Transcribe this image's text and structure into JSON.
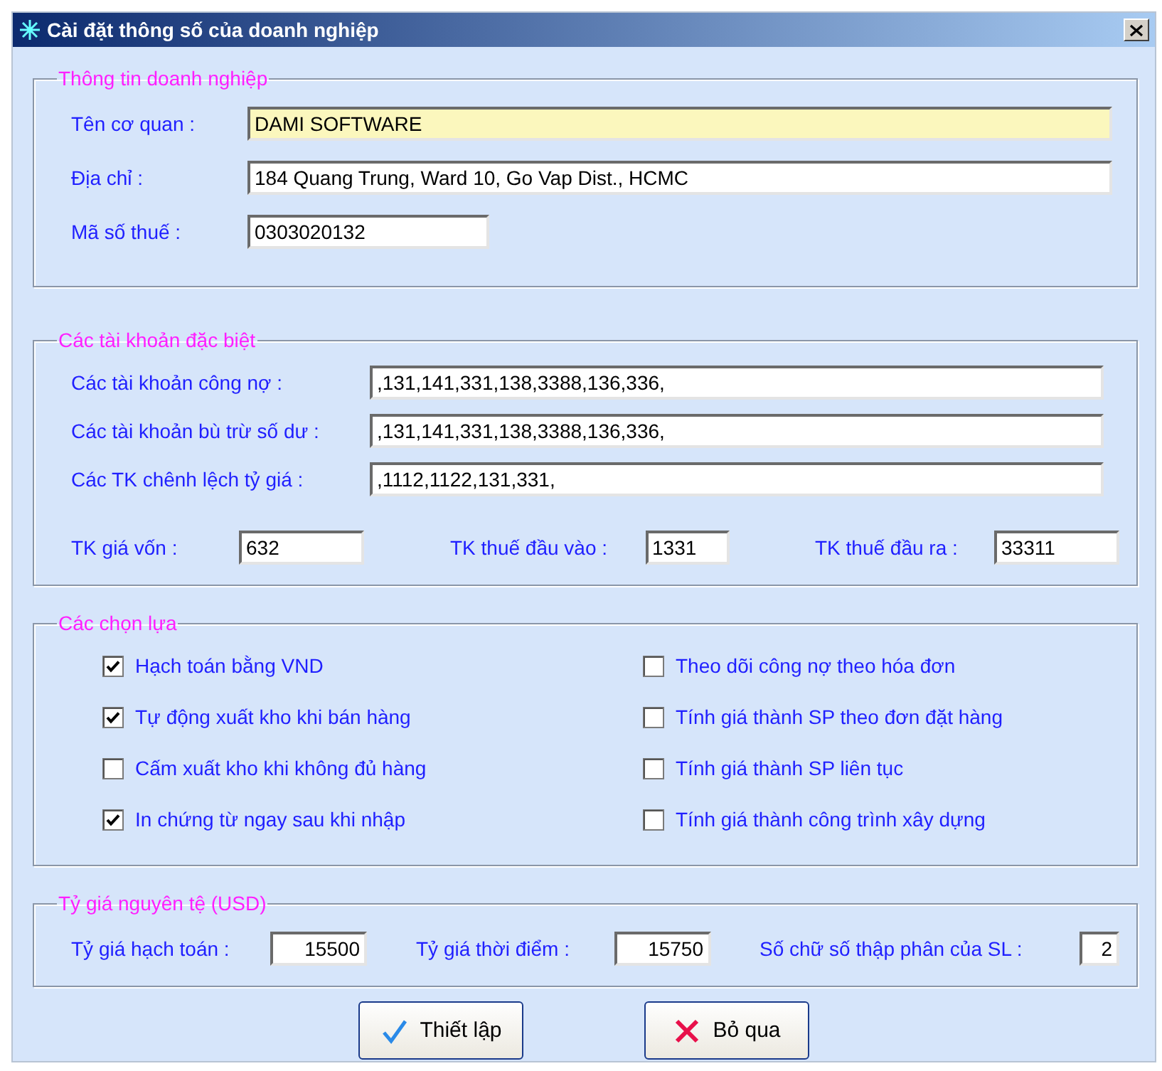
{
  "window": {
    "title": "Cài đặt thông số của doanh nghiệp"
  },
  "company": {
    "legend": "Thông tin doanh nghiệp",
    "fields": [
      {
        "label": "Tên cơ quan :",
        "value": "DAMI SOFTWARE",
        "focused": true
      },
      {
        "label": "Địa chỉ :",
        "value": "184 Quang Trung, Ward 10, Go Vap Dist., HCMC",
        "focused": false
      },
      {
        "label": "Mã số thuế :",
        "value": "0303020132",
        "focused": false
      }
    ]
  },
  "accounts": {
    "legend": "Các tài khoản đặc biệt",
    "fields": [
      {
        "label": "Các tài khoản công nợ :",
        "value": ",131,141,331,138,3388,136,336,"
      },
      {
        "label": "Các tài khoản bù trừ số dư :",
        "value": ",131,141,331,138,3388,136,336,"
      },
      {
        "label": "Các TK chênh lệch tỷ giá :",
        "value": ",1112,1122,131,331,"
      }
    ],
    "short_fields": [
      {
        "label": "TK giá vốn :",
        "value": "632"
      },
      {
        "label": "TK thuế đầu vào :",
        "value": "1331"
      },
      {
        "label": "TK thuế đầu ra :",
        "value": "33311"
      }
    ]
  },
  "options": {
    "legend": "Các chọn lựa",
    "columns": [
      [
        {
          "label": "Hạch toán bằng VND",
          "checked": true
        },
        {
          "label": "Tự động xuất kho khi bán hàng",
          "checked": true
        },
        {
          "label": "Cấm xuất kho khi không đủ hàng",
          "checked": false
        },
        {
          "label": "In chứng từ ngay sau khi nhập",
          "checked": true
        }
      ],
      [
        {
          "label": "Theo dõi công nợ theo hóa đơn",
          "checked": false
        },
        {
          "label": "Tính giá thành SP theo đơn đặt hàng",
          "checked": false
        },
        {
          "label": "Tính giá thành SP liên tục",
          "checked": false
        },
        {
          "label": "Tính giá thành công trình xây dựng",
          "checked": false
        }
      ]
    ]
  },
  "exchange": {
    "legend": "Tỷ giá nguyên tệ (USD)",
    "fields": [
      {
        "label": "Tỷ giá hạch toán :",
        "value": "15500"
      },
      {
        "label": "Tỷ giá thời điểm :",
        "value": "15750"
      },
      {
        "label": "Số chữ số thập phân của SL :",
        "value": "2"
      }
    ]
  },
  "buttons": [
    {
      "label": "Thiết lập",
      "kind": "confirm"
    },
    {
      "label": "Bỏ qua",
      "kind": "cancel"
    }
  ]
}
